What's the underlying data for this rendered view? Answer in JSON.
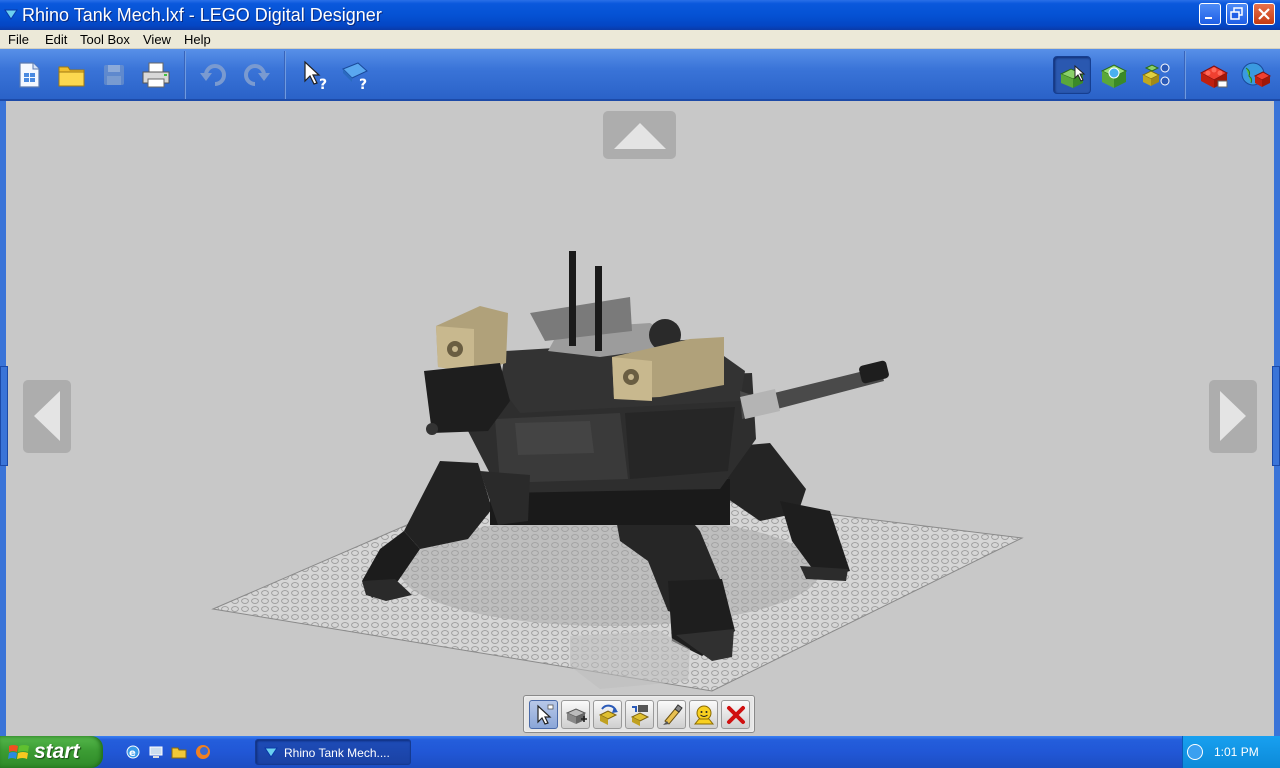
{
  "window": {
    "title": "Rhino Tank Mech.lxf - LEGO Digital Designer"
  },
  "menu": {
    "items": [
      "File",
      "Edit",
      "Tool Box",
      "View",
      "Help"
    ]
  },
  "toolbar": {
    "left_icons": [
      "new-file-icon",
      "open-folder-icon",
      "save-icon",
      "print-icon",
      "undo-icon",
      "redo-icon",
      "help-pointer-icon",
      "help-book-icon"
    ],
    "right_icons": [
      "build-mode-icon",
      "view-mode-icon",
      "building-guide-mode-icon",
      "lego-brick-icon",
      "online-gallery-icon"
    ],
    "active_mode": "build-mode-icon"
  },
  "palette": {
    "tools": [
      "select-tool-icon",
      "clone-tool-icon",
      "hinge-tool-icon",
      "hinge-align-tool-icon",
      "paint-tool-icon",
      "decoration-tool-icon",
      "delete-tool-icon"
    ],
    "active_tool": "select-tool-icon"
  },
  "taskbar": {
    "start_label": "start",
    "task_label": "Rhino Tank Mech....",
    "clock": "1:01 PM"
  },
  "colors": {
    "title_blue": "#0552d4",
    "toolbar_blue": "#3a74d8",
    "viewport_gray": "#c8c8c8",
    "start_green": "#3c9c34"
  }
}
